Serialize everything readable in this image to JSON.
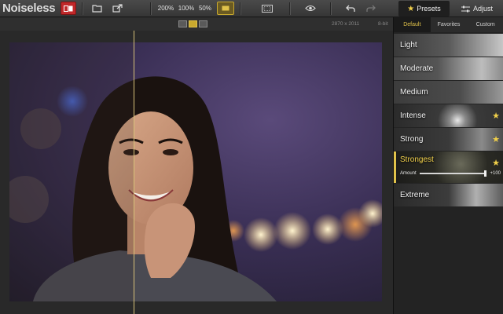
{
  "app": {
    "title": "Noiseless"
  },
  "toolbar": {
    "zoom_200": "200%",
    "zoom_100": "100%",
    "zoom_50": "50%",
    "tabs": {
      "presets": "Presets",
      "adjust": "Adjust"
    }
  },
  "image_info": {
    "size": "2870 x 2011",
    "bit_depth": "8-bit"
  },
  "panel": {
    "subtabs": [
      "Default",
      "Favorites",
      "Custom"
    ],
    "active_subtab": "Default",
    "presets": [
      {
        "label": "Light",
        "favorite": false
      },
      {
        "label": "Moderate",
        "favorite": false
      },
      {
        "label": "Medium",
        "favorite": false
      },
      {
        "label": "Intense",
        "favorite": true
      },
      {
        "label": "Strong",
        "favorite": true
      },
      {
        "label": "Strongest",
        "favorite": true,
        "selected": true
      },
      {
        "label": "Extreme",
        "favorite": false
      }
    ],
    "amount": {
      "label": "Amount",
      "value": "+100",
      "level": 1.0
    }
  },
  "colors": {
    "accent": "#e0c24a",
    "compare_red": "#c0282a",
    "star": "#f1d04a"
  },
  "icons": [
    "compare-icon",
    "folder-icon",
    "share-icon",
    "fit-screen-icon",
    "fullscreen-icon",
    "eye-icon",
    "undo-icon",
    "redo-icon",
    "star-icon",
    "sliders-icon"
  ]
}
